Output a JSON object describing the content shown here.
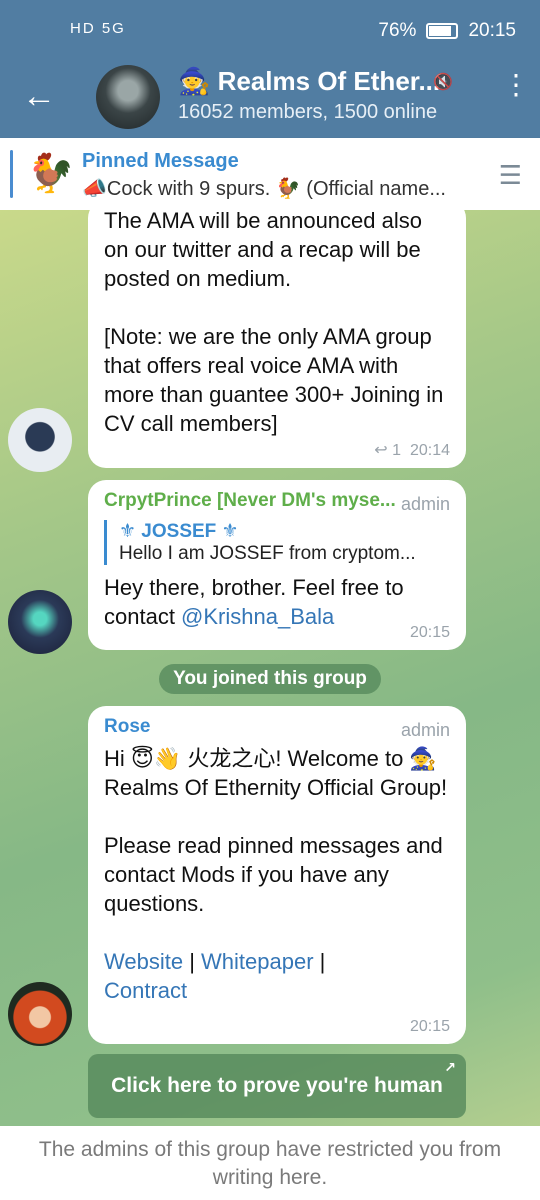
{
  "status_bar": {
    "network": "HD 5G",
    "battery": "76%",
    "time": "20:15"
  },
  "header": {
    "title": "Realms Of Ether...",
    "title_emoji": "🧙",
    "subtitle": "16052 members, 1500 online",
    "back_icon": "back-arrow-icon",
    "menu_icon": "more-vert-icon",
    "mute_icon": "muted-icon"
  },
  "pinned": {
    "title": "Pinned Message",
    "text": "📣Cock with 9 spurs. 🐓 (Official name...",
    "thumb": "🐓"
  },
  "messages": [
    {
      "text": "The AMA will be announced also on our twitter and a recap will be posted on medium.\n\n[Note: we are the only AMA group that offers real voice AMA with more than guantee 300+ Joining in CV call members]",
      "replies": "1",
      "time": "20:14"
    },
    {
      "sender": "CrpytPrince [Never DM's myse...",
      "badge": "admin",
      "quote_name": "⚜ JOSSEF ⚜",
      "quote_text": "Hello I am JOSSEF from cryptom...",
      "text_before": "Hey there, brother. Feel free to contact ",
      "mention": "@Krishna_Bala",
      "time": "20:15"
    },
    {
      "sender": "Rose",
      "badge": "admin",
      "text": "Hi 😇👋 火龙之心! Welcome to 🧙 Realms Of Ethernity Official Group!\n\nPlease read pinned messages and contact Mods if you have any questions.",
      "link_website": "Website",
      "sep1": " | ",
      "link_whitepaper": "Whitepaper",
      "sep2": " |",
      "link_contract": "Contract",
      "time": "20:15"
    }
  ],
  "system_message": "You joined this group",
  "human_button": "Click here to prove you're human",
  "footer": "The admins of this group have restricted you from writing here.",
  "colors": {
    "header": "#517da2",
    "sender_green": "#5fae4a",
    "sender_blue": "#3a8bd0",
    "link": "#3576b6"
  }
}
